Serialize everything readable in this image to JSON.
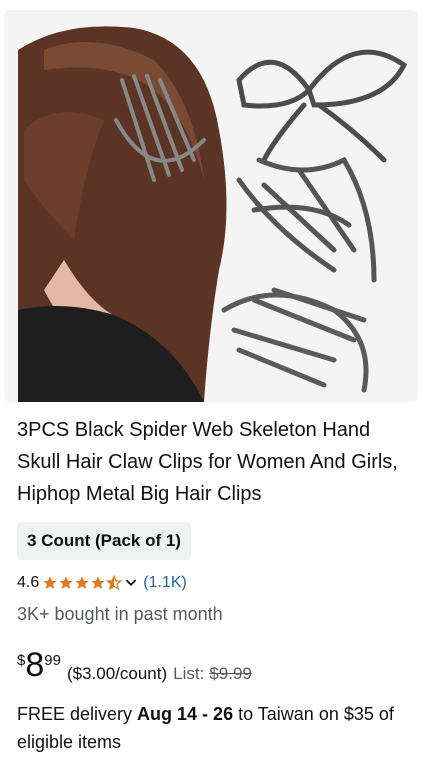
{
  "product": {
    "title": "3PCS Black Spider Web Skeleton Hand Skull Hair Claw Clips for Women And Girls, Hiphop Metal Big Hair Clips",
    "variant": "3 Count (Pack of 1)",
    "rating": {
      "value": "4.6",
      "stars": 4.5,
      "count": "(1.1K)"
    },
    "bought": "3K+ bought in past month",
    "price": {
      "currency": "$",
      "whole": "8",
      "fraction": "99",
      "unit": "($3.00/count)",
      "list_label": "List:",
      "list_price": "$9.99"
    },
    "delivery": {
      "prefix": "FREE delivery",
      "dates": "Aug 14 - 26",
      "suffix": "to Taiwan on $35 of eligible items"
    }
  },
  "colors": {
    "star": "#de7921",
    "link": "#2162a1",
    "muted": "#565959",
    "chip_bg": "#f0f2f2"
  }
}
